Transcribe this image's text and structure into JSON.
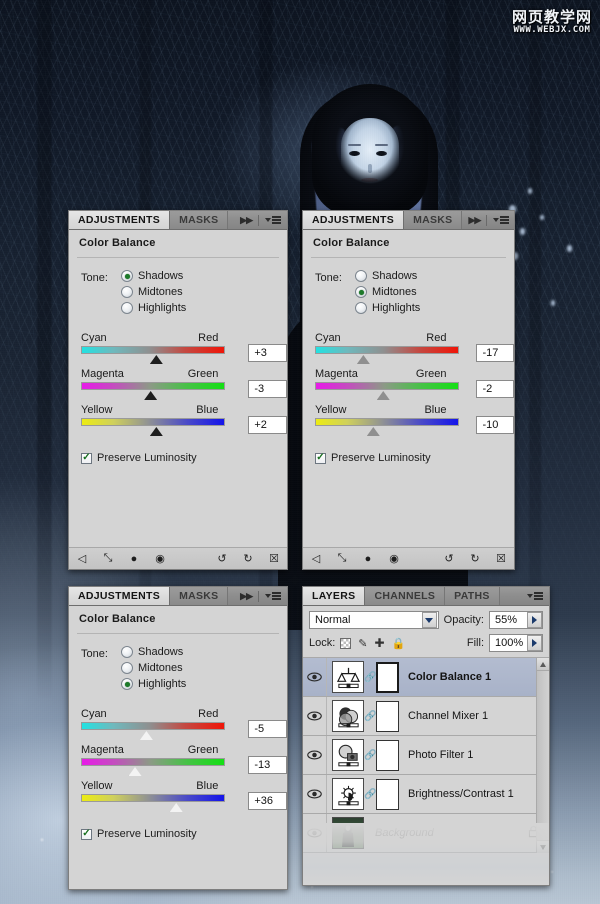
{
  "watermark": {
    "cn": "网页教学网",
    "url": "WWW.WEBJX.COM"
  },
  "common": {
    "tab_adjustments": "ADJUSTMENTS",
    "tab_masks": "MASKS",
    "panel_title": "Color Balance",
    "tone_label": "Tone:",
    "tone_shadows": "Shadows",
    "tone_midtones": "Midtones",
    "tone_highlights": "Highlights",
    "cap_cyan": "Cyan",
    "cap_red": "Red",
    "cap_magenta": "Magenta",
    "cap_green": "Green",
    "cap_yellow": "Yellow",
    "cap_blue": "Blue",
    "preserve_luminosity": "Preserve Luminosity",
    "check_glyph": "✓",
    "dbl_arrow": "▶▶",
    "footer_icons": [
      {
        "name": "return-to-adjustment-list-icon",
        "glyph": "◁"
      },
      {
        "name": "expanded-view-icon",
        "glyph": "⤡"
      },
      {
        "name": "clip-to-layer-icon",
        "glyph": "●"
      },
      {
        "name": "toggle-layer-visibility-icon",
        "glyph": "◉"
      },
      {
        "name": "preview-previous-state-icon",
        "glyph": "↺"
      },
      {
        "name": "reset-adjustment-icon",
        "glyph": "↻"
      },
      {
        "name": "delete-adjustment-layer-icon",
        "glyph": "☒"
      }
    ]
  },
  "panel_shadows": {
    "selected_tone": "Shadows",
    "sliders": [
      {
        "name": "cyan-red",
        "value": "+3",
        "thumb_pct": 52,
        "style": "dark"
      },
      {
        "name": "magenta-green",
        "value": "-3",
        "thumb_pct": 48,
        "style": "dark"
      },
      {
        "name": "yellow-blue",
        "value": "+2",
        "thumb_pct": 52,
        "style": "dark"
      }
    ],
    "preserve_checked": true
  },
  "panel_midtones": {
    "selected_tone": "Midtones",
    "sliders": [
      {
        "name": "cyan-red",
        "value": "-17",
        "thumb_pct": 33,
        "style": "grey"
      },
      {
        "name": "magenta-green",
        "value": "-2",
        "thumb_pct": 47,
        "style": "grey"
      },
      {
        "name": "yellow-blue",
        "value": "-10",
        "thumb_pct": 40,
        "style": "grey"
      }
    ],
    "preserve_checked": true
  },
  "panel_highlights": {
    "selected_tone": "Highlights",
    "sliders": [
      {
        "name": "cyan-red",
        "value": "-5",
        "thumb_pct": 45,
        "style": "light"
      },
      {
        "name": "magenta-green",
        "value": "-13",
        "thumb_pct": 37,
        "style": "light"
      },
      {
        "name": "yellow-blue",
        "value": "+36",
        "thumb_pct": 66,
        "style": "light"
      }
    ],
    "preserve_checked": true
  },
  "layers_panel": {
    "tabs": [
      {
        "label": "LAYERS",
        "active": true
      },
      {
        "label": "CHANNELS",
        "active": false
      },
      {
        "label": "PATHS",
        "active": false
      }
    ],
    "blend_mode": "Normal",
    "opacity_label": "Opacity:",
    "opacity_value": "55%",
    "lock_label": "Lock:",
    "fill_label": "Fill:",
    "fill_value": "100%",
    "lock_icons": [
      {
        "name": "lock-transparent-pixels-icon",
        "glyph": "░"
      },
      {
        "name": "lock-image-pixels-icon",
        "glyph": "✐"
      },
      {
        "name": "lock-position-icon",
        "glyph": "✥"
      },
      {
        "name": "lock-all-icon",
        "glyph": "ὑ2"
      }
    ],
    "layers": [
      {
        "name": "Color Balance 1",
        "kind": "color-balance",
        "selected": true,
        "bold": true,
        "italic": false,
        "has_mask": true,
        "mask_selected": true,
        "locked": false,
        "visible": true
      },
      {
        "name": "Channel Mixer 1",
        "kind": "channel-mixer",
        "selected": false,
        "bold": false,
        "italic": false,
        "has_mask": true,
        "mask_selected": false,
        "locked": false,
        "visible": true
      },
      {
        "name": "Photo Filter 1",
        "kind": "photo-filter",
        "selected": false,
        "bold": false,
        "italic": false,
        "has_mask": true,
        "mask_selected": false,
        "locked": false,
        "visible": true
      },
      {
        "name": "Brightness/Contrast 1",
        "kind": "brightness-contrast",
        "selected": false,
        "bold": false,
        "italic": false,
        "has_mask": true,
        "mask_selected": false,
        "locked": false,
        "visible": true
      },
      {
        "name": "Background",
        "kind": "background",
        "selected": false,
        "bold": false,
        "italic": true,
        "has_mask": false,
        "mask_selected": false,
        "locked": true,
        "visible": true
      }
    ],
    "lock_glyph": "🔒"
  }
}
